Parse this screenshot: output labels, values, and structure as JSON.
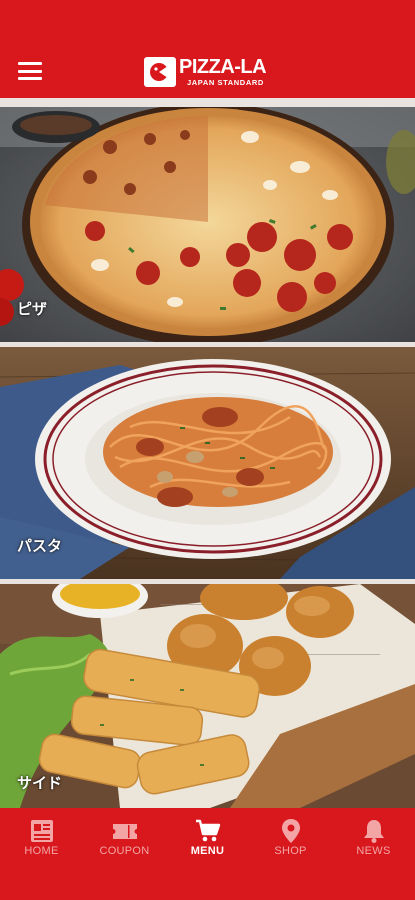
{
  "header": {
    "menu_icon": "hamburger-icon",
    "logo_name": "PIZZA-LA",
    "logo_sub": "JAPAN STANDARD"
  },
  "categories": [
    {
      "label": "ピザ"
    },
    {
      "label": "パスタ"
    },
    {
      "label": "サイド"
    }
  ],
  "tabbar": {
    "items": [
      {
        "label": "HOME",
        "icon": "home-news-icon"
      },
      {
        "label": "COUPON",
        "icon": "ticket-icon"
      },
      {
        "label": "MENU",
        "icon": "cart-icon"
      },
      {
        "label": "SHOP",
        "icon": "location-pin-icon"
      },
      {
        "label": "NEWS",
        "icon": "bell-icon"
      }
    ],
    "active": "MENU"
  },
  "colors": {
    "brand_red": "#d8181d",
    "tab_inactive": "#f3a5a5",
    "tab_active": "#ffffff"
  }
}
